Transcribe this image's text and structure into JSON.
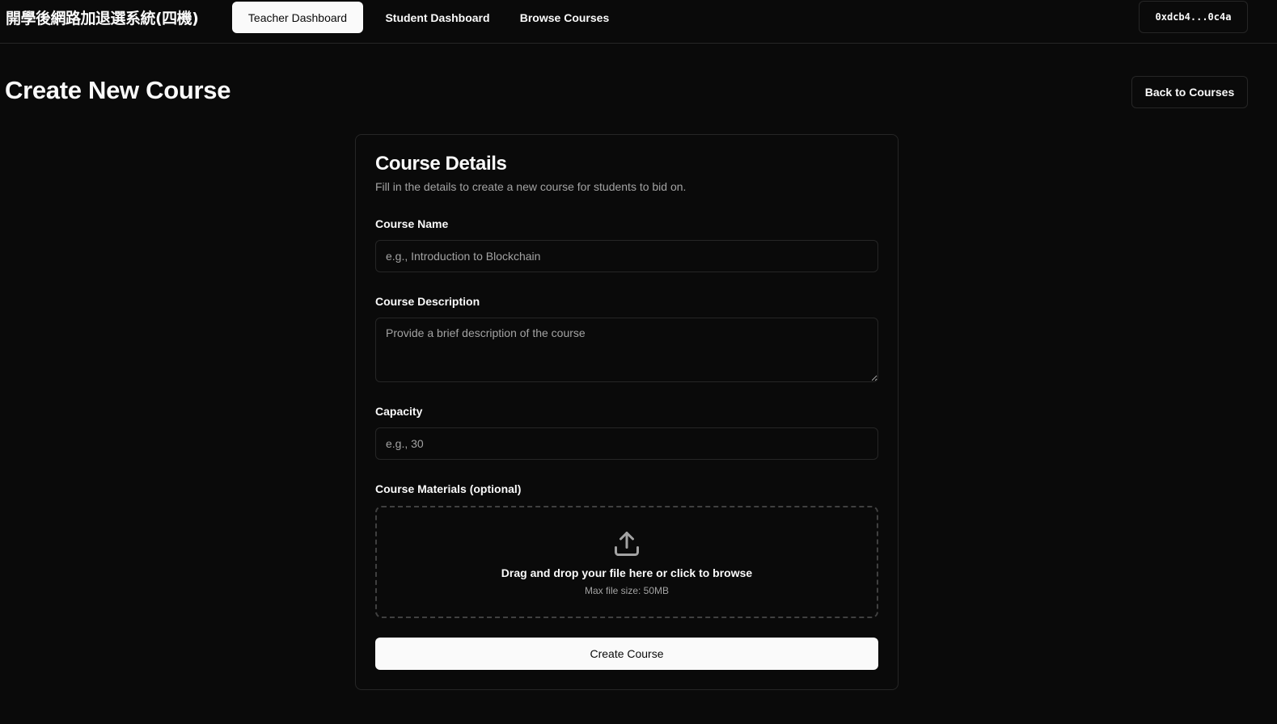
{
  "header": {
    "brand": "開學後網路加退選系統(四機)",
    "nav": [
      {
        "label": "Teacher Dashboard",
        "active": true
      },
      {
        "label": "Student Dashboard",
        "active": false
      },
      {
        "label": "Browse Courses",
        "active": false
      }
    ],
    "wallet": "0xdcb4...0c4a"
  },
  "page": {
    "title": "Create New Course",
    "back_label": "Back to Courses"
  },
  "form": {
    "title": "Course Details",
    "subtitle": "Fill in the details to create a new course for students to bid on.",
    "course_name": {
      "label": "Course Name",
      "placeholder": "e.g., Introduction to Blockchain",
      "value": ""
    },
    "course_description": {
      "label": "Course Description",
      "placeholder": "Provide a brief description of the course",
      "value": ""
    },
    "capacity": {
      "label": "Capacity",
      "placeholder": "e.g., 30",
      "value": ""
    },
    "materials": {
      "label": "Course Materials (optional)",
      "icon": "upload-icon",
      "drop_text": "Drag and drop your file here or click to browse",
      "hint": "Max file size: 50MB"
    },
    "submit_label": "Create Course"
  },
  "colors": {
    "background": "#0a0a0a",
    "foreground": "#fafafa",
    "muted": "#a3a3a3",
    "border": "#262626"
  }
}
